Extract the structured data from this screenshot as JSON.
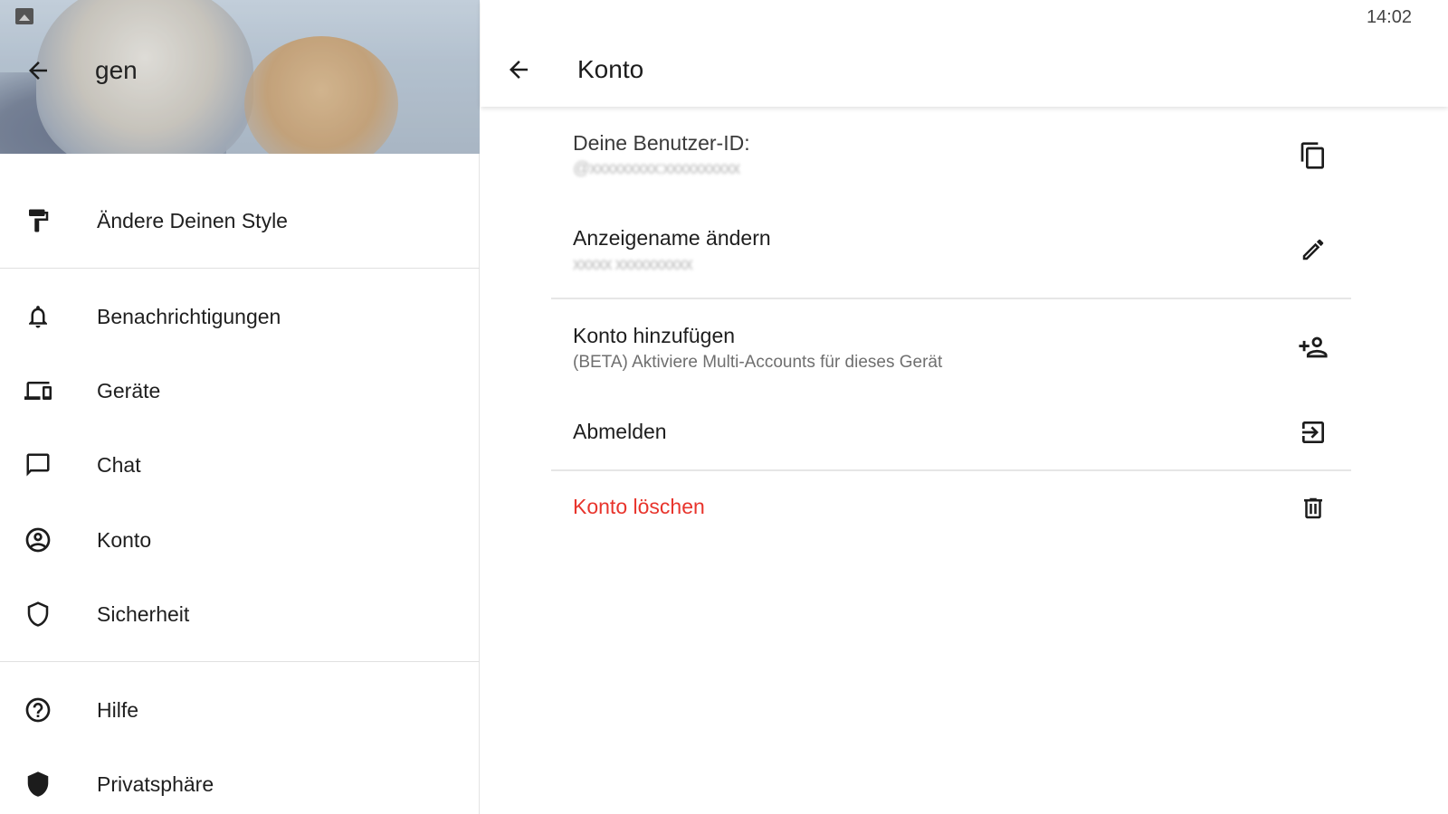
{
  "status": {
    "time": "14:02"
  },
  "left": {
    "title": "gen",
    "menu": [
      {
        "label": "Ändere Deinen Style",
        "icon": "paint-roller-icon"
      },
      {
        "label": "Benachrichtigungen",
        "icon": "bell-icon"
      },
      {
        "label": "Geräte",
        "icon": "devices-icon"
      },
      {
        "label": "Chat",
        "icon": "chat-bubble-icon"
      },
      {
        "label": "Konto",
        "icon": "account-circle-icon"
      },
      {
        "label": "Sicherheit",
        "icon": "shield-outline-icon"
      },
      {
        "label": "Hilfe",
        "icon": "help-circle-icon"
      },
      {
        "label": "Privatsphäre",
        "icon": "shield-filled-icon"
      }
    ]
  },
  "right": {
    "title": "Konto",
    "user_id": {
      "label": "Deine Benutzer-ID:",
      "value": "@xxxxxxxxx:xxxxxxxxxx"
    },
    "display_name": {
      "label": "Anzeigename ändern",
      "value": "xxxxx xxxxxxxxxx"
    },
    "add_account": {
      "label": "Konto hinzufügen",
      "description": "(BETA) Aktiviere Multi-Accounts für dieses Gerät"
    },
    "logout": {
      "label": "Abmelden"
    },
    "delete": {
      "label": "Konto löschen"
    }
  },
  "colors": {
    "danger": "#e8342c",
    "divider": "#e6e6e6",
    "text": "#1e1e1e",
    "subtext": "#6f6f6f"
  }
}
